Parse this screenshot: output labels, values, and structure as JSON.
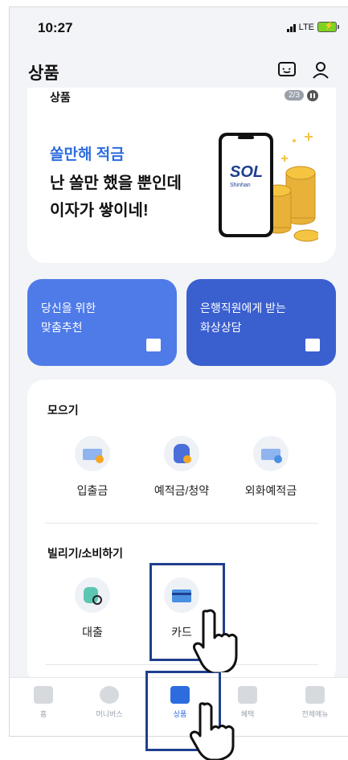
{
  "status": {
    "time": "10:27",
    "network": "LTE"
  },
  "header": {
    "title": "상품",
    "icons": [
      "chat-icon",
      "profile-icon"
    ]
  },
  "banner": {
    "label": "상품",
    "pager": "2/3",
    "subtitle": "쏠만해 적금",
    "line1": "난 쏠만 했을 뿐인데",
    "line2": "이자가 쌓이네!",
    "phone_text": "SOL",
    "phone_sub": "Shinhan"
  },
  "tiles": [
    {
      "line1": "당신을 위한",
      "line2": "맞춤추천",
      "color": "#4f7be8"
    },
    {
      "line1": "은행직원에게 받는",
      "line2": "화상상담",
      "color": "#3a5fcf"
    }
  ],
  "sections": {
    "save": {
      "title": "모으기",
      "items": [
        "입출금",
        "예적금/청약",
        "외화예적금"
      ]
    },
    "borrow": {
      "title": "빌리기/소비하기",
      "items": [
        "대출",
        "카드"
      ]
    }
  },
  "tabbar": {
    "items": [
      "홈",
      "머니버스",
      "상품",
      "혜택",
      "전체메뉴"
    ],
    "active": "상품"
  },
  "colors": {
    "accent": "#2d6cdf",
    "highlight": "#1f3f8f"
  }
}
